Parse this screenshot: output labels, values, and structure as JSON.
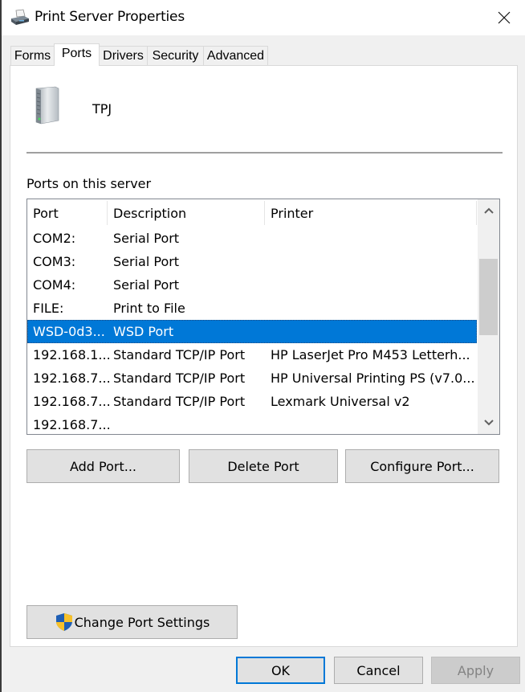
{
  "window": {
    "title": "Print Server Properties",
    "icon": "printer-icon",
    "close_icon": "close-icon"
  },
  "tabs": [
    {
      "label": "Forms",
      "selected": false
    },
    {
      "label": "Ports",
      "selected": true
    },
    {
      "label": "Drivers",
      "selected": false
    },
    {
      "label": "Security",
      "selected": false
    },
    {
      "label": "Advanced",
      "selected": false
    }
  ],
  "server": {
    "icon": "server-icon",
    "name": "TPJ"
  },
  "ports_section": {
    "label": "Ports on this server",
    "columns": [
      "Port",
      "Description",
      "Printer"
    ],
    "rows": [
      {
        "port": "COM2:",
        "description": "Serial Port",
        "printer": "",
        "selected": false
      },
      {
        "port": "COM3:",
        "description": "Serial Port",
        "printer": "",
        "selected": false
      },
      {
        "port": "COM4:",
        "description": "Serial Port",
        "printer": "",
        "selected": false
      },
      {
        "port": "FILE:",
        "description": "Print to File",
        "printer": "",
        "selected": false
      },
      {
        "port": "WSD-0d3...",
        "description": "WSD Port",
        "printer": "",
        "selected": true
      },
      {
        "port": "192.168.1...",
        "description": "Standard TCP/IP Port",
        "printer": "HP LaserJet Pro M453 Letterh...",
        "selected": false
      },
      {
        "port": "192.168.7...",
        "description": "Standard TCP/IP Port",
        "printer": "HP Universal Printing PS (v7.0....",
        "selected": false
      },
      {
        "port": "192.168.7...",
        "description": "Standard TCP/IP Port",
        "printer": "Lexmark Universal v2",
        "selected": false
      },
      {
        "port": "192.168.7...",
        "description": "",
        "printer": "",
        "selected": false
      }
    ],
    "scrollbar": {
      "up_icon": "chevron-up-icon",
      "down_icon": "chevron-down-icon"
    }
  },
  "port_buttons": {
    "add": "Add Port...",
    "delete": "Delete Port",
    "configure": "Configure Port..."
  },
  "change_port_settings": {
    "label": "Change Port Settings",
    "icon": "uac-shield-icon"
  },
  "dialog_buttons": {
    "ok": "OK",
    "cancel": "Cancel",
    "apply": "Apply"
  },
  "colors": {
    "selection": "#0078d7",
    "default_button_border": "#0078d7"
  }
}
